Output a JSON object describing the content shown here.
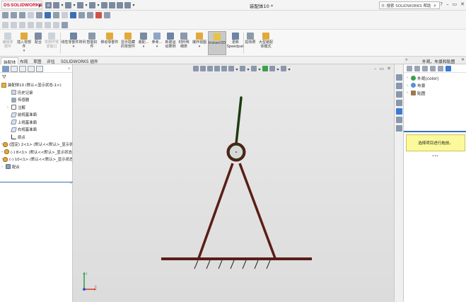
{
  "app": {
    "logo_text": "SOLIDWORKS",
    "logo_mark": "DS",
    "document_title": "装配体10 *"
  },
  "search": {
    "placeholder": "搜索 SOLIDWORKS 帮助"
  },
  "command_manager": {
    "buttons": [
      {
        "label": "编辑零\n部件",
        "enabled": false
      },
      {
        "label": "插入零部件",
        "enabled": true
      },
      {
        "label": "配合",
        "enabled": true
      },
      {
        "label": "零部件预览窗口",
        "enabled": false
      },
      {
        "label": "线性零部件阵列",
        "enabled": true
      },
      {
        "label": "智能扣件",
        "enabled": true
      },
      {
        "label": "移动零部件",
        "enabled": true
      },
      {
        "label": "显示隐藏的零部件",
        "enabled": true
      },
      {
        "label": "装配...",
        "enabled": true
      },
      {
        "label": "参考...",
        "enabled": true
      },
      {
        "label": "新建运动算例",
        "enabled": true
      },
      {
        "label": "材料明细表",
        "enabled": true
      },
      {
        "label": "爆炸视图",
        "enabled": true
      },
      {
        "label": "Instant3D",
        "enabled": true,
        "active": true
      },
      {
        "label": "更新Speedpak",
        "enabled": true
      },
      {
        "label": "拍快照",
        "enabled": true
      },
      {
        "label": "大型装配体模式",
        "enabled": true
      }
    ]
  },
  "tabs": [
    "装配体",
    "布局",
    "草图",
    "评估",
    "SOLIDWORKS 插件"
  ],
  "feature_tree": {
    "root": "装配体10 (默认<显示状态-1>)",
    "items": [
      {
        "label": "历史记录",
        "icon": "history-icon"
      },
      {
        "label": "传感器",
        "icon": "sensor-icon"
      },
      {
        "label": "注解",
        "icon": "annotation-icon"
      },
      {
        "label": "前视基准面",
        "icon": "plane-icon"
      },
      {
        "label": "上视基准面",
        "icon": "plane-icon"
      },
      {
        "label": "右视基准面",
        "icon": "plane-icon"
      },
      {
        "label": "原点",
        "icon": "origin-icon"
      },
      {
        "label": "(固定) 2<1> (默认<<默认>_显示状",
        "icon": "part-icon"
      },
      {
        "label": "(-) 8<1> (默认<<默认>_显示状态",
        "icon": "part-icon"
      },
      {
        "label": "(-) 10<1> (默认<<默认>_显示状态",
        "icon": "part-icon"
      },
      {
        "label": "配合",
        "icon": "mates-icon"
      }
    ]
  },
  "task_pane": {
    "title": "外观、布景和贴图",
    "items": [
      {
        "label": "外观(color)",
        "color": "#3aa04a"
      },
      {
        "label": "布景",
        "color": "#5c8fd6"
      },
      {
        "label": "贴图",
        "color": "#9a7b4f"
      }
    ],
    "hint": "选择项目进行拖放。"
  },
  "colors": {
    "accent": "#3a6fb5",
    "model_rod": "#5a1e16",
    "model_joint": "#1f3b12",
    "hint_bg": "#fbf99a"
  },
  "triad": {
    "x": "X",
    "y": "Y"
  }
}
